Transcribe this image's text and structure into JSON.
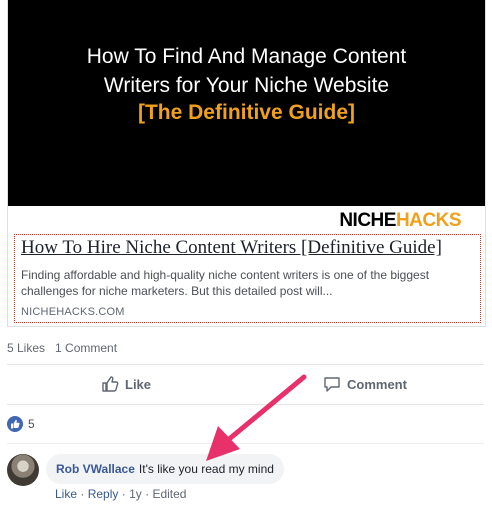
{
  "hero": {
    "line1": "How To Find And Manage Content",
    "line2": "Writers for Your Niche Website",
    "line3": "[The Definitive Guide]",
    "brand_niche": "NICHE",
    "brand_hacks": "HACKS"
  },
  "link": {
    "title": "How To Hire Niche Content Writers [Definitive Guide]",
    "description": "Finding affordable and high-quality niche content writers is one of the biggest challenges for niche marketers. But this detailed post will...",
    "domain": "NICHEHACKS.COM"
  },
  "stats": {
    "likes": "5 Likes",
    "comments": "1 Comment"
  },
  "actions": {
    "like": "Like",
    "comment": "Comment"
  },
  "reactions": {
    "count": "5"
  },
  "comment": {
    "author": "Rob VWallace",
    "text": "It's like you read my mind",
    "like": "Like",
    "reply": "Reply",
    "time": "1y",
    "edited": "Edited"
  },
  "colors": {
    "accent": "#f0a11c",
    "link": "#385898",
    "like_badge": "#4267b2",
    "annotation_arrow": "#e8306a"
  }
}
